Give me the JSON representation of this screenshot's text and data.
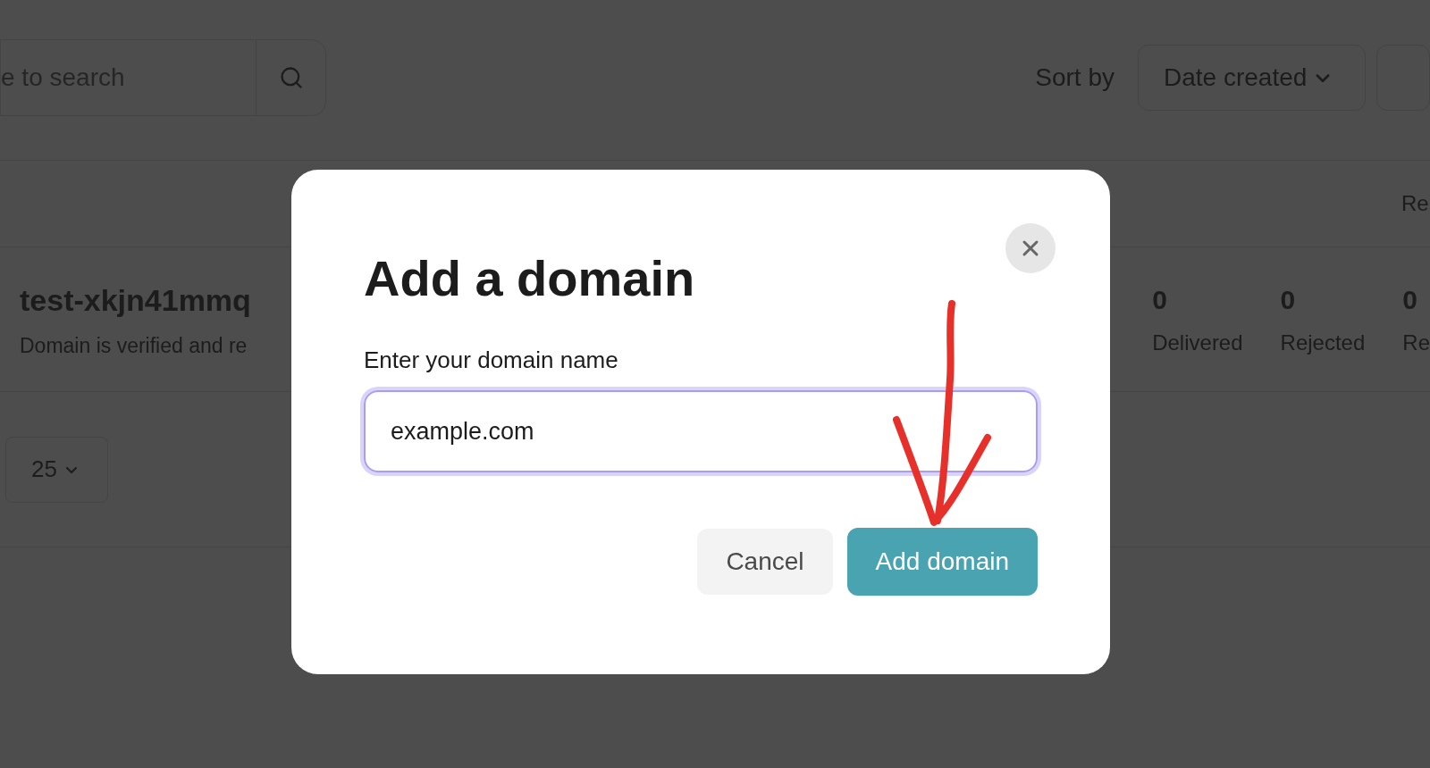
{
  "search": {
    "placeholder": "e to search"
  },
  "sort": {
    "label": "Sort by",
    "value": "Date created"
  },
  "table": {
    "columns": [
      "Re"
    ],
    "rows": [
      {
        "name": "test-xkjn41mmq",
        "status": "Domain is verified and re",
        "stats": [
          {
            "value": "0",
            "label": "Delivered"
          },
          {
            "value": "0",
            "label": "Rejected"
          },
          {
            "value": "0",
            "label": "Re"
          }
        ]
      }
    ]
  },
  "pagination": {
    "page_size": "25"
  },
  "dialog": {
    "title": "Add a domain",
    "field": {
      "label": "Enter your domain name",
      "value": "example.com",
      "focused": true
    },
    "buttons": [
      {
        "label": "Cancel",
        "kind": "secondary"
      },
      {
        "label": "Add domain",
        "kind": "primary"
      }
    ]
  }
}
